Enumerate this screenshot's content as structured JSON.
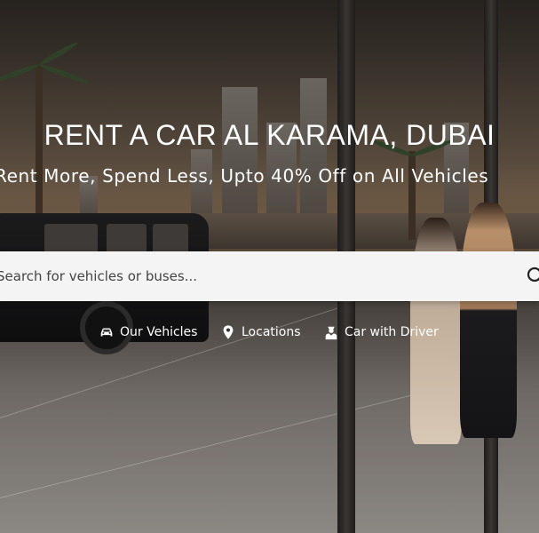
{
  "hero": {
    "title": "RENT A CAR AL KARAMA, DUBAI",
    "subtitle": "Rent More, Spend Less, Upto 40% Off on All Vehicles"
  },
  "search": {
    "placeholder": "Search for vehicles or buses...",
    "icon": "search-icon"
  },
  "nav": {
    "items": [
      {
        "label": "Our Vehicles",
        "icon": "car-icon"
      },
      {
        "label": "Locations",
        "icon": "location-pin-icon"
      },
      {
        "label": "Car with Driver",
        "icon": "driver-icon"
      }
    ]
  }
}
